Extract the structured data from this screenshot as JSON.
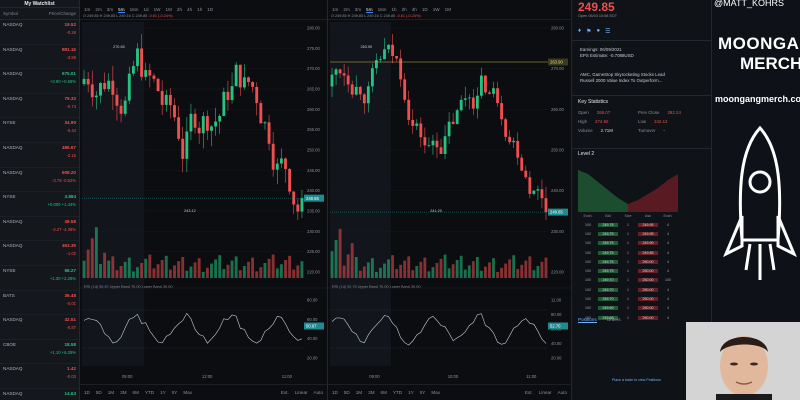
{
  "watchlist": {
    "title": "My Watchlist",
    "col_left": "Symbol",
    "col_right": "Price/Change",
    "rows": [
      {
        "name": "NASDAQ",
        "price": "19.52",
        "change": "-0.28",
        "dir": "down"
      },
      {
        "name": "NASDAQ",
        "price": "881.15",
        "change": "-3.59",
        "dir": "down"
      },
      {
        "name": "NASDAQ",
        "price": "675.01",
        "change": "+3.90 +0.58%",
        "dir": "up"
      },
      {
        "name": "NASDAQ",
        "price": "79.32",
        "change": "-0.74",
        "dir": "down"
      },
      {
        "name": "NYSE",
        "price": "34.90",
        "change": "-0.44",
        "dir": "down"
      },
      {
        "name": "NASDAQ",
        "price": "486.67",
        "change": "-2.16",
        "dir": "down"
      },
      {
        "name": "NASDAQ",
        "price": "608.20",
        "change": "-3.78 -0.62%",
        "dir": "down"
      },
      {
        "name": "NYSE",
        "price": "3.884",
        "change": "+0.000 +1.44%",
        "dir": "up"
      },
      {
        "name": "NASDAQ",
        "price": "49.58",
        "change": "-2.27 -4.38%",
        "dir": "down"
      },
      {
        "name": "NASDAQ",
        "price": "463.39",
        "change": "-1.02",
        "dir": "down"
      },
      {
        "name": "NYSE",
        "price": "58.27",
        "change": "+1.30 +2.28%",
        "dir": "up"
      },
      {
        "name": "BATS",
        "price": "36.48",
        "change": "-0.01",
        "dir": "down"
      },
      {
        "name": "NASDAQ",
        "price": "42.51",
        "change": "-0.87",
        "dir": "down"
      },
      {
        "name": "CBOE",
        "price": "18.58",
        "change": "+1.10 +6.29%",
        "dir": "up"
      },
      {
        "name": "NASDAQ",
        "price": "1.42",
        "change": "-0.03",
        "dir": "down"
      },
      {
        "name": "NASDAQ",
        "price": "14.63",
        "change": "+0.71 +5.09%",
        "dir": "up"
      }
    ]
  },
  "left_chart": {
    "timeframes": [
      "1m",
      "2m",
      "3m",
      "5m",
      "15m",
      "1d",
      "1W",
      "1M",
      "2h",
      "4h",
      "1h",
      "1D"
    ],
    "active_timeframe": "5m",
    "ohlc_text": "O 249.85  H 249.85  L 249.16  C 249.85",
    "change_text": "-0.61 (-0.24%)",
    "y_ticks": [
      "280.00",
      "275.00",
      "270.00",
      "265.00",
      "260.00",
      "255.00",
      "250.00",
      "245.00",
      "240.00",
      "235.00",
      "230.00",
      "225.00",
      "220.00"
    ],
    "price_tag": "249.85",
    "annotations": {
      "high": "270.65",
      "low": "243.12"
    },
    "rsi_label": "RSI (14)  50.87  Upper Band 70.00  Lower Band 30.00",
    "rsi_ticks": [
      "80.00",
      "60.00",
      "40.00",
      "20.00"
    ],
    "rsi_tag": "50.87",
    "x_ticks": [
      "09:00",
      "12:00",
      "11:00"
    ],
    "bottom_ranges": [
      "1D",
      "5D",
      "1M",
      "3M",
      "6M",
      "YTD",
      "1Y",
      "5Y",
      "Max"
    ],
    "bottom_right": [
      "Ext.",
      "Linear",
      "Auto"
    ]
  },
  "right_chart": {
    "timeframes": [
      "1m",
      "2m",
      "3m",
      "5m",
      "15m",
      "1h",
      "2h",
      "4h",
      "1D",
      "1W",
      "1M"
    ],
    "active_timeframe": "5m",
    "ohlc_text": "O 249.85  H 249.85  L 249.16  C 249.85",
    "change_text": "-0.61 (-0.24%)",
    "y_ticks": [
      "280.00",
      "270.00",
      "260.00",
      "250.00",
      "240.00",
      "230.00",
      "220.00"
    ],
    "price_tag": "249.85",
    "line_tag": "263.90",
    "annotations": {
      "high": "263.90",
      "low": "241.20"
    },
    "rsi_label": "RSI (14)  52.70  Upper Band 70.00  Lower Band 30.00",
    "rsi_ticks": [
      "11.00",
      "80.00",
      "60.00",
      "40.00",
      "20.00"
    ],
    "rsi_tag": "52.70",
    "x_ticks": [
      "09:00",
      "10:00",
      "11:00"
    ],
    "bottom_ranges": [
      "1D",
      "5D",
      "1M",
      "3M",
      "6M",
      "YTD",
      "1Y",
      "5Y",
      "Max"
    ],
    "bottom_right": [
      "Ext.",
      "Linear",
      "Auto"
    ]
  },
  "info": {
    "price": "249.85",
    "time": "Open 06/03 10:58 EDT",
    "earnings": "Earnings: 06/09/2021",
    "eps": "EPS Estimate: -0.7088USD",
    "news1": "AMC, GameStop Skyrocketing Stocks Lead",
    "news2": "Russell 2000 Value Index To Outperform...",
    "key_stats_title": "Key Statistics",
    "stats": [
      {
        "k": "Open",
        "v": "265.07"
      },
      {
        "k": "Prev Close",
        "v": "282.24"
      },
      {
        "k": "High",
        "v": "274.92"
      },
      {
        "k": "Low",
        "v": "242.12"
      },
      {
        "k": "Volume",
        "v": "2.71M"
      },
      {
        "k": "Turnover",
        "v": "-"
      }
    ],
    "level2_title": "Level 2",
    "l2_headers": [
      "Exch.",
      "Bid",
      "Size",
      "Ask",
      "Exch."
    ],
    "l2_rows": [
      [
        "100",
        "249.78",
        "1",
        "249.95",
        "4"
      ],
      [
        "100",
        "249.75",
        "1",
        "249.95",
        "4"
      ],
      [
        "100",
        "249.75",
        "1",
        "249.90",
        "4"
      ],
      [
        "100",
        "249.75",
        "1",
        "249.85",
        "4"
      ],
      [
        "100",
        "249.75",
        "1",
        "250.00",
        "4"
      ],
      [
        "100",
        "249.75",
        "1",
        "250.00",
        "4"
      ],
      [
        "100",
        "249.70",
        "1",
        "250.00",
        "100"
      ],
      [
        "100",
        "249.70",
        "1",
        "250.00",
        "4"
      ],
      [
        "100",
        "249.70",
        "1",
        "250.00",
        "4"
      ],
      [
        "100",
        "249.69",
        "1",
        "250.00",
        "4"
      ],
      [
        "100",
        "249.65",
        "1",
        "250.00",
        "4"
      ]
    ],
    "tab_positions": "Positions",
    "tab_orders": "Orders",
    "empty_text": "Place a trade to view Positions"
  },
  "promo": {
    "handle": "@MATT_KOHRS",
    "brand_line1": "MOONGANG",
    "brand_line2": "MERCH",
    "site": "moongangmerch.com"
  },
  "colors": {
    "up": "#26c281",
    "down": "#ef4f4f",
    "accent": "#3d8af7"
  }
}
